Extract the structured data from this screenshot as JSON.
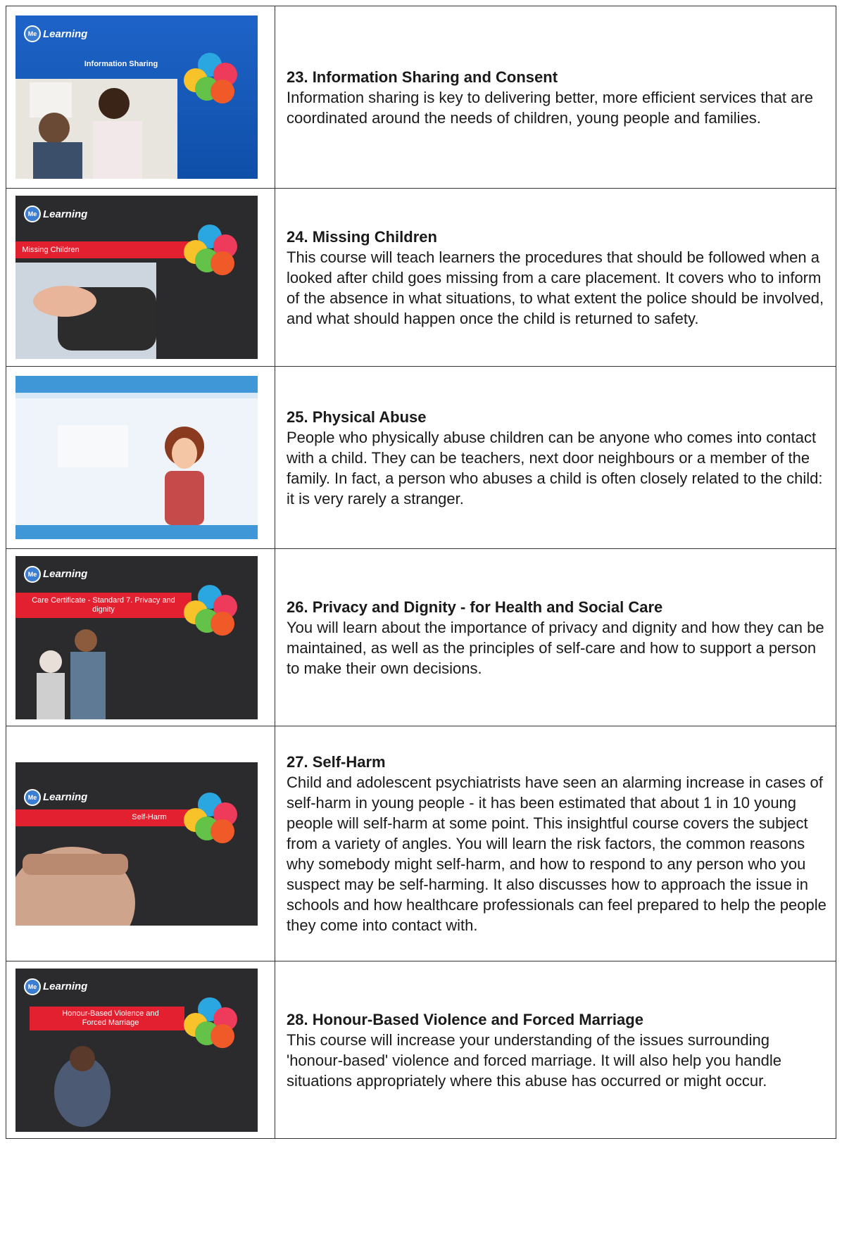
{
  "logo_text": "Learning",
  "logo_mark": "Me",
  "courses": [
    {
      "title": "23. Information Sharing and Consent",
      "desc": "Information sharing is key to delivering better, more efficient services that are coordinated around the needs of children, young people and families.",
      "thumb_banner": "Information Sharing",
      "thumb_theme": "blue"
    },
    {
      "title": "24. Missing Children",
      "desc": "This course will teach learners the procedures that should be followed when a looked after child goes missing from a care placement. It covers who to inform of the absence in what situations, to what extent the police should be involved, and what should happen once the child is returned to safety.",
      "thumb_banner": "Missing Children",
      "thumb_theme": "dark"
    },
    {
      "title": "25. Physical Abuse",
      "desc": "People who physically abuse children can be anyone who comes into contact with a child. They can be teachers, next door neighbours or a member of the family. In fact, a person who abuses a child is often closely related to the child: it is very rarely a stranger.",
      "thumb_banner": "",
      "thumb_theme": "light"
    },
    {
      "title": "26. Privacy and Dignity - for Health and Social Care",
      "desc": "You will learn about the importance of privacy and dignity and how they can be maintained, as well as the principles of self-care and how to support a person to make their own decisions.",
      "thumb_banner": "Care Certificate - Standard 7. Privacy and dignity",
      "thumb_theme": "dark"
    },
    {
      "title": "27. Self-Harm",
      "desc": "Child and adolescent psychiatrists have seen an alarming increase in cases of self-harm in young people - it has been estimated that about 1 in 10 young people will self-harm at some point. This insightful course covers the subject from a variety of angles. You will learn the risk factors, the common reasons why somebody might self-harm, and how to respond to any person who you suspect may be self-harming. It also discusses how to approach the issue in schools and how healthcare professionals can feel prepared to help the people they come into contact with.",
      "thumb_banner": "Self-Harm",
      "thumb_theme": "dark"
    },
    {
      "title": "28. Honour-Based Violence and Forced Marriage",
      "desc": "This course will increase your understanding of the issues surrounding 'honour-based' violence and forced marriage. It will also help you handle situations appropriately where this abuse has occurred or might occur.",
      "thumb_banner": "Honour-Based Violence and Forced Marriage",
      "thumb_theme": "dark"
    }
  ]
}
